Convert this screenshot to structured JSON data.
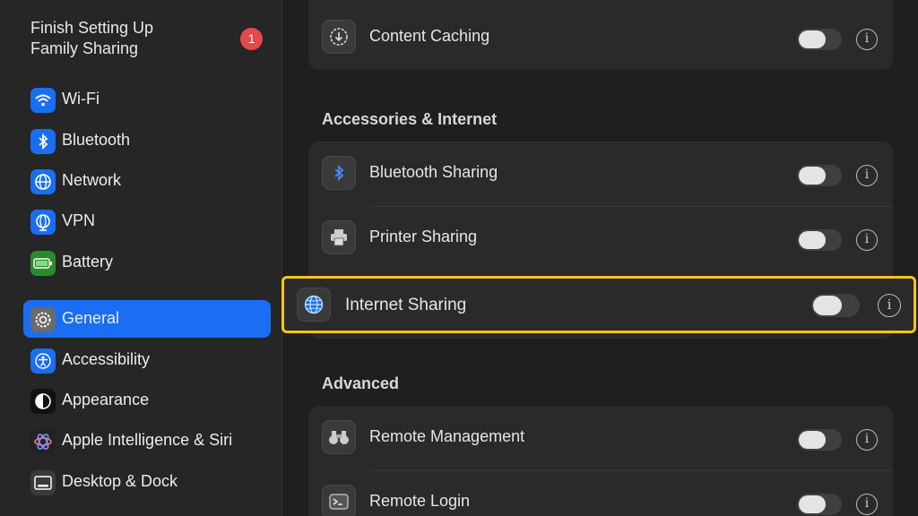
{
  "sidebar": {
    "setup_notice": {
      "label": "Finish Setting Up Family Sharing",
      "badge": "1"
    },
    "items": [
      {
        "label": "Wi-Fi",
        "icon": "wifi-icon"
      },
      {
        "label": "Bluetooth",
        "icon": "bluetooth-icon"
      },
      {
        "label": "Network",
        "icon": "globe-icon"
      },
      {
        "label": "VPN",
        "icon": "vpn-globe-icon"
      },
      {
        "label": "Battery",
        "icon": "battery-icon"
      },
      {
        "label": "General",
        "icon": "gear-icon",
        "selected": true
      },
      {
        "label": "Accessibility",
        "icon": "accessibility-icon"
      },
      {
        "label": "Appearance",
        "icon": "appearance-icon"
      },
      {
        "label": "Apple Intelligence & Siri",
        "icon": "siri-icon"
      },
      {
        "label": "Desktop & Dock",
        "icon": "dock-icon"
      }
    ]
  },
  "main": {
    "top_card": {
      "rows": [
        {
          "label": "Content Caching",
          "enabled": false
        }
      ]
    },
    "sections": [
      {
        "title": "Accessories & Internet",
        "rows": [
          {
            "label": "Bluetooth Sharing",
            "enabled": false
          },
          {
            "label": "Printer Sharing",
            "enabled": false
          },
          {
            "label": "Internet Sharing",
            "enabled": false,
            "highlighted": true
          }
        ]
      },
      {
        "title": "Advanced",
        "rows": [
          {
            "label": "Remote Management",
            "enabled": false
          },
          {
            "label": "Remote Login",
            "enabled": false
          }
        ]
      }
    ]
  },
  "colors": {
    "accent": "#1a6ef3",
    "highlight_border": "#f5c518",
    "badge": "#e5484d"
  }
}
